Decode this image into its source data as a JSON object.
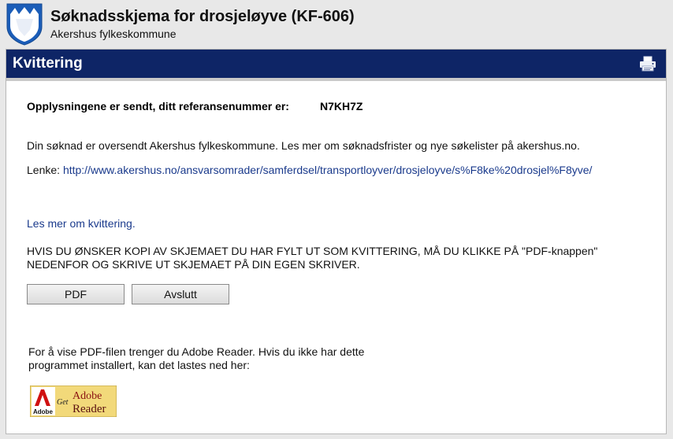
{
  "header": {
    "title": "Søknadsskjema for drosjeløyve (KF-606)",
    "subtitle": "Akershus fylkeskommune"
  },
  "panel": {
    "title": "Kvittering"
  },
  "receipt": {
    "ref_label": "Opplysningene er sendt, ditt referansenummer er:",
    "ref_code": "N7KH7Z",
    "info": "Din søknad er oversendt Akershus fylkeskommune. Les mer om søknadsfrister og nye søkelister på akershus.no.",
    "link_label": "Lenke:",
    "link_url": "http://www.akershus.no/ansvarsomrader/samferdsel/transportloyver/drosjeloyve/s%F8ke%20drosjel%F8yve/",
    "more_link": "Les mer om kvittering.",
    "instructions": "HVIS DU ØNSKER KOPI AV SKJEMAET DU HAR FYLT UT SOM KVITTERING, MÅ DU KLIKKE PÅ \"PDF-knappen\" NEDENFOR OG SKRIVE UT SKJEMAET PÅ DIN EGEN SKRIVER."
  },
  "buttons": {
    "pdf": "PDF",
    "exit": "Avslutt"
  },
  "reader": {
    "note": "For å vise PDF-filen trenger du Adobe Reader. Hvis du ikke har dette programmet installert, kan det lastes ned her:",
    "badge": {
      "brand": "Adobe",
      "get": "Get",
      "line1": "Adobe",
      "line2": "Reader"
    }
  },
  "colors": {
    "bar": "#0e2566",
    "link": "#1a3a8c",
    "badge_bg": "#f2d97a"
  }
}
